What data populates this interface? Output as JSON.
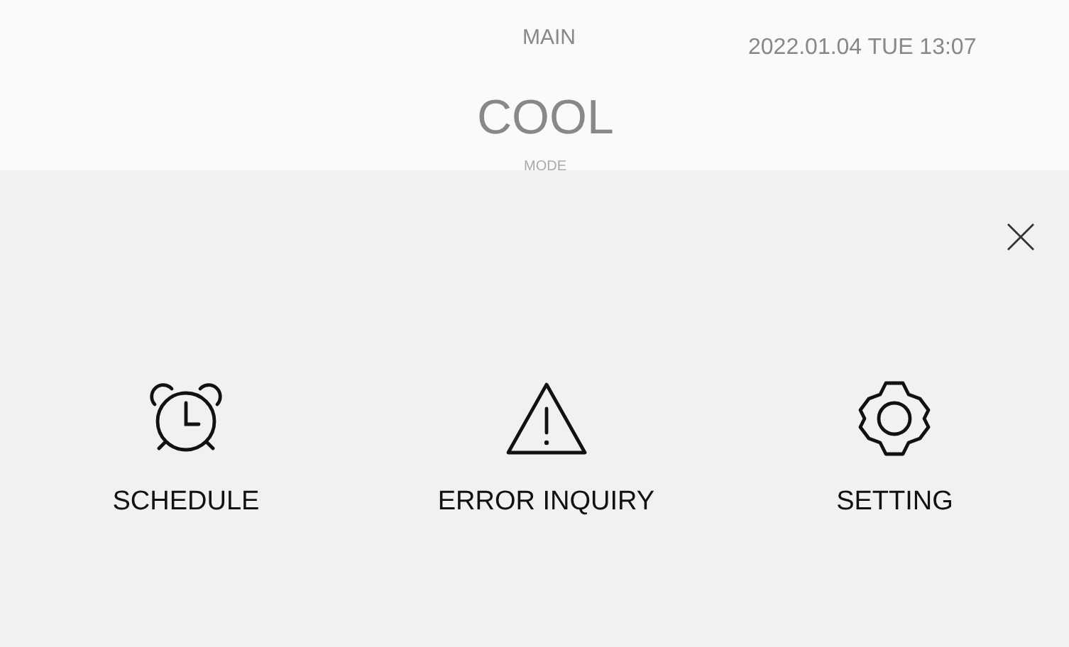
{
  "header": {
    "title": "MAIN",
    "datetime": "2022.01.04 TUE 13:07",
    "mode_value": "COOL",
    "mode_label": "MODE"
  },
  "menu": {
    "items": [
      {
        "kind": "alarm",
        "label": "SCHEDULE"
      },
      {
        "kind": "warning",
        "label": "ERROR INQUIRY"
      },
      {
        "kind": "gear",
        "label": "SETTING"
      }
    ]
  }
}
